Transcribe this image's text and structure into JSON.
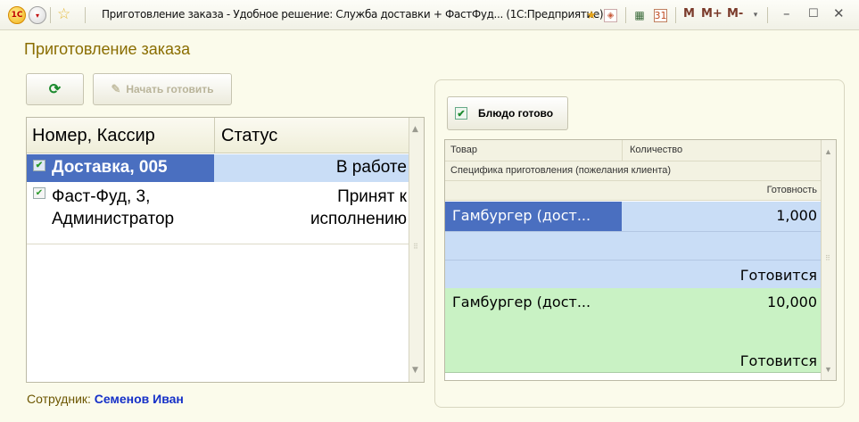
{
  "window": {
    "title": "Приготовление заказа - Удобное решение: Служба доставки + ФастФуд...  (1С:Предприятие)",
    "logo_text": "1С",
    "tools": [
      "M",
      "M+",
      "M-"
    ],
    "icons": [
      "app-logo",
      "main-menu",
      "favorites-star",
      "favorites-add",
      "history",
      "calculator",
      "calendar",
      "minimize",
      "maximize",
      "close"
    ]
  },
  "form": {
    "title": "Приготовление заказа",
    "refresh_icon": "⟳",
    "start_cooking_label": "Начать готовить"
  },
  "orders_table": {
    "columns": [
      "Номер, Кассир",
      "Статус"
    ],
    "rows": [
      {
        "line1": "Доставка, 005",
        "line2": "",
        "status_line1": "В работе",
        "status_line2": ""
      },
      {
        "line1": "Фаст-Фуд, 3,",
        "line2": "Администратор",
        "status_line1": "Принят к",
        "status_line2": "исполнению"
      }
    ]
  },
  "employee": {
    "label": "Сотрудник:",
    "name": "Семенов Иван"
  },
  "dish_panel": {
    "done_label": "Блюдо готово",
    "columns": {
      "product": "Товар",
      "quantity": "Количество",
      "spec": "Специфика приготовления (пожелания клиента)",
      "readiness": "Готовность"
    },
    "rows": [
      {
        "product": "Гамбургер (дост...",
        "quantity": "1,000",
        "status": "Готовится"
      },
      {
        "product": "Гамбургер (дост...",
        "quantity": "10,000",
        "status": "Готовится"
      }
    ]
  },
  "colors": {
    "selected_row": "#4a6fc0",
    "selected_row_light": "#c9ddf6",
    "ready_row": "#c9f2c4",
    "form_title": "#8a6d00",
    "employee_name": "#1530c8"
  }
}
